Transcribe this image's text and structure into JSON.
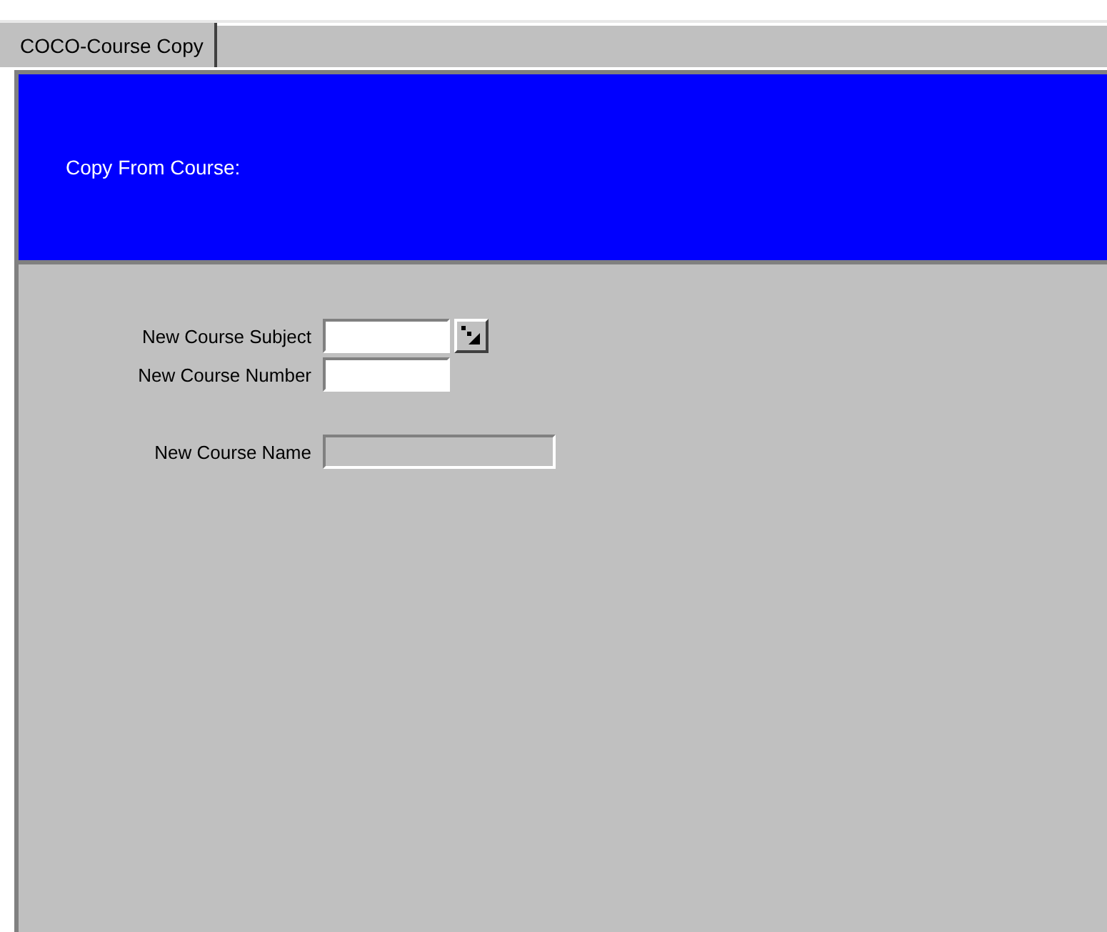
{
  "tabs": [
    {
      "label": "COCO-Course Copy",
      "selected": true
    }
  ],
  "header": {
    "title": "Copy From Course:"
  },
  "field_groups": [
    [
      {
        "label": "New Course Subject",
        "disabled": false,
        "lookup": true
      },
      {
        "label": "New Course Number",
        "disabled": false,
        "lookup": false
      }
    ],
    [
      {
        "label": "New Course Name",
        "disabled": true,
        "lookup": false
      }
    ]
  ]
}
